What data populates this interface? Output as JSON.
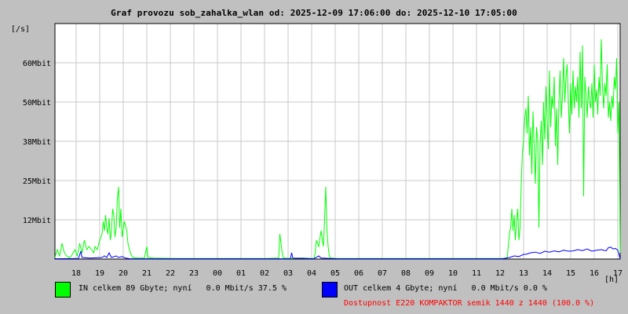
{
  "chart_data": {
    "type": "line",
    "title": "Graf provozu sob_zahalka_wlan od: 2025-12-09 17:06:00 do: 2025-12-10 17:05:00",
    "ylabel": "[/s]",
    "xlabel": "[h]",
    "x_ticks": [
      "18",
      "19",
      "20",
      "21",
      "22",
      "23",
      "00",
      "01",
      "02",
      "03",
      "04",
      "05",
      "06",
      "07",
      "08",
      "09",
      "10",
      "11",
      "12",
      "13",
      "14",
      "15",
      "16",
      "17"
    ],
    "y_ticks": [
      {
        "value": 12.5,
        "label": "12Mbit"
      },
      {
        "value": 25,
        "label": "25Mbit"
      },
      {
        "value": 37.5,
        "label": "38Mbit"
      },
      {
        "value": 50,
        "label": "50Mbit"
      },
      {
        "value": 62.5,
        "label": "60Mbit"
      }
    ],
    "x_range_hours": [
      0,
      24
    ],
    "ylim": [
      0,
      75
    ],
    "grid": true,
    "series": [
      {
        "name": "IN",
        "color": "#00ff00",
        "points": [
          [
            0.0,
            0.5
          ],
          [
            0.1,
            3
          ],
          [
            0.2,
            1
          ],
          [
            0.3,
            5
          ],
          [
            0.4,
            2
          ],
          [
            0.5,
            1
          ],
          [
            0.6,
            0.5
          ],
          [
            0.7,
            1
          ],
          [
            0.85,
            3
          ],
          [
            0.95,
            1
          ],
          [
            1.05,
            5
          ],
          [
            1.15,
            2
          ],
          [
            1.25,
            6
          ],
          [
            1.35,
            3
          ],
          [
            1.45,
            4
          ],
          [
            1.55,
            3
          ],
          [
            1.65,
            2
          ],
          [
            1.7,
            4
          ],
          [
            1.8,
            3
          ],
          [
            1.9,
            6
          ],
          [
            2.0,
            8
          ],
          [
            2.05,
            12
          ],
          [
            2.1,
            9
          ],
          [
            2.15,
            14
          ],
          [
            2.2,
            10
          ],
          [
            2.25,
            8
          ],
          [
            2.3,
            13
          ],
          [
            2.35,
            6
          ],
          [
            2.4,
            9
          ],
          [
            2.45,
            16
          ],
          [
            2.5,
            14
          ],
          [
            2.55,
            7
          ],
          [
            2.6,
            10
          ],
          [
            2.65,
            19
          ],
          [
            2.7,
            23
          ],
          [
            2.75,
            10
          ],
          [
            2.8,
            16
          ],
          [
            2.85,
            7
          ],
          [
            2.95,
            12
          ],
          [
            3.05,
            9
          ],
          [
            3.1,
            5
          ],
          [
            3.2,
            2
          ],
          [
            3.3,
            0.5
          ],
          [
            3.5,
            0.3
          ],
          [
            3.8,
            0.3
          ],
          [
            3.9,
            4
          ],
          [
            3.95,
            0.5
          ],
          [
            4.2,
            0.3
          ],
          [
            5.0,
            0.2
          ],
          [
            6.0,
            0.2
          ],
          [
            7.0,
            0.2
          ],
          [
            8.0,
            0.2
          ],
          [
            9.0,
            0.2
          ],
          [
            9.5,
            0.3
          ],
          [
            9.55,
            8
          ],
          [
            9.6,
            5
          ],
          [
            9.65,
            2
          ],
          [
            9.7,
            0.3
          ],
          [
            10.0,
            0.2
          ],
          [
            10.5,
            0.3
          ],
          [
            11.0,
            0.2
          ],
          [
            11.05,
            2
          ],
          [
            11.1,
            6
          ],
          [
            11.2,
            4
          ],
          [
            11.3,
            9
          ],
          [
            11.4,
            4
          ],
          [
            11.45,
            13
          ],
          [
            11.5,
            23
          ],
          [
            11.55,
            9
          ],
          [
            11.6,
            4
          ],
          [
            11.65,
            1
          ],
          [
            11.7,
            0.3
          ],
          [
            12.0,
            0.2
          ],
          [
            13.0,
            0.2
          ],
          [
            14.0,
            0.2
          ],
          [
            15.0,
            0.2
          ],
          [
            16.0,
            0.2
          ],
          [
            17.0,
            0.2
          ],
          [
            18.0,
            0.2
          ],
          [
            19.0,
            0.2
          ],
          [
            19.2,
            0.3
          ],
          [
            19.25,
            4
          ],
          [
            19.3,
            8
          ],
          [
            19.35,
            10
          ],
          [
            19.4,
            16
          ],
          [
            19.45,
            9
          ],
          [
            19.5,
            14
          ],
          [
            19.55,
            6
          ],
          [
            19.6,
            12
          ],
          [
            19.65,
            16
          ],
          [
            19.7,
            6
          ],
          [
            19.75,
            10
          ],
          [
            19.8,
            24
          ],
          [
            19.85,
            34
          ],
          [
            19.9,
            38
          ],
          [
            19.95,
            45
          ],
          [
            20.0,
            48
          ],
          [
            20.05,
            40
          ],
          [
            20.1,
            52
          ],
          [
            20.15,
            33
          ],
          [
            20.2,
            42
          ],
          [
            20.25,
            27
          ],
          [
            20.3,
            47
          ],
          [
            20.35,
            36
          ],
          [
            20.4,
            24
          ],
          [
            20.45,
            42
          ],
          [
            20.5,
            38
          ],
          [
            20.55,
            10
          ],
          [
            20.6,
            37
          ],
          [
            20.65,
            44
          ],
          [
            20.7,
            30
          ],
          [
            20.75,
            50
          ],
          [
            20.8,
            38
          ],
          [
            20.85,
            55
          ],
          [
            20.9,
            44
          ],
          [
            20.95,
            35
          ],
          [
            21.0,
            60
          ],
          [
            21.05,
            42
          ],
          [
            21.1,
            52
          ],
          [
            21.15,
            48
          ],
          [
            21.2,
            58
          ],
          [
            21.25,
            36
          ],
          [
            21.3,
            48
          ],
          [
            21.35,
            30
          ],
          [
            21.4,
            50
          ],
          [
            21.45,
            60
          ],
          [
            21.5,
            45
          ],
          [
            21.55,
            52
          ],
          [
            21.6,
            64
          ],
          [
            21.65,
            50
          ],
          [
            21.7,
            58
          ],
          [
            21.75,
            62
          ],
          [
            21.8,
            50
          ],
          [
            21.85,
            40
          ],
          [
            21.9,
            56
          ],
          [
            21.95,
            46
          ],
          [
            22.0,
            60
          ],
          [
            22.05,
            48
          ],
          [
            22.1,
            55
          ],
          [
            22.15,
            50
          ],
          [
            22.2,
            58
          ],
          [
            22.25,
            45
          ],
          [
            22.3,
            66
          ],
          [
            22.35,
            48
          ],
          [
            22.4,
            68
          ],
          [
            22.45,
            20
          ],
          [
            22.5,
            58
          ],
          [
            22.55,
            52
          ],
          [
            22.6,
            45
          ],
          [
            22.65,
            55
          ],
          [
            22.7,
            50
          ],
          [
            22.75,
            48
          ],
          [
            22.8,
            56
          ],
          [
            22.85,
            45
          ],
          [
            22.9,
            62
          ],
          [
            22.95,
            50
          ],
          [
            23.0,
            54
          ],
          [
            23.05,
            46
          ],
          [
            23.1,
            58
          ],
          [
            23.15,
            52
          ],
          [
            23.2,
            70
          ],
          [
            23.25,
            55
          ],
          [
            23.3,
            48
          ],
          [
            23.35,
            56
          ],
          [
            23.4,
            52
          ],
          [
            23.45,
            62
          ],
          [
            23.5,
            45
          ],
          [
            23.55,
            50
          ],
          [
            23.6,
            44
          ],
          [
            23.65,
            52
          ],
          [
            23.7,
            48
          ],
          [
            23.75,
            58
          ],
          [
            23.8,
            54
          ],
          [
            23.85,
            64
          ],
          [
            23.9,
            40
          ],
          [
            23.95,
            50
          ],
          [
            24.0,
            2
          ]
        ]
      },
      {
        "name": "OUT",
        "color": "#0000ff",
        "points": [
          [
            0.0,
            0.1
          ],
          [
            1.0,
            0.2
          ],
          [
            1.1,
            2.5
          ],
          [
            1.15,
            0.5
          ],
          [
            1.5,
            0.3
          ],
          [
            2.0,
            0.5
          ],
          [
            2.1,
            1
          ],
          [
            2.2,
            0.5
          ],
          [
            2.3,
            2
          ],
          [
            2.4,
            0.5
          ],
          [
            2.6,
            1
          ],
          [
            2.7,
            0.5
          ],
          [
            2.85,
            0.8
          ],
          [
            3.0,
            0.3
          ],
          [
            3.2,
            0.1
          ],
          [
            9.0,
            0.1
          ],
          [
            10.0,
            0.1
          ],
          [
            10.05,
            2
          ],
          [
            10.1,
            0.3
          ],
          [
            11.0,
            0.1
          ],
          [
            11.2,
            1
          ],
          [
            11.3,
            0.3
          ],
          [
            12.0,
            0.1
          ],
          [
            19.0,
            0.1
          ],
          [
            19.3,
            0.5
          ],
          [
            19.5,
            1
          ],
          [
            19.7,
            0.8
          ],
          [
            19.9,
            1.5
          ],
          [
            20.0,
            1.5
          ],
          [
            20.2,
            2
          ],
          [
            20.4,
            2.2
          ],
          [
            20.6,
            1.8
          ],
          [
            20.8,
            2.5
          ],
          [
            21.0,
            2.2
          ],
          [
            21.2,
            2.6
          ],
          [
            21.4,
            2.3
          ],
          [
            21.6,
            2.8
          ],
          [
            21.8,
            2.5
          ],
          [
            22.0,
            2.6
          ],
          [
            22.2,
            3.0
          ],
          [
            22.4,
            2.7
          ],
          [
            22.6,
            3.2
          ],
          [
            22.8,
            2.5
          ],
          [
            23.0,
            2.8
          ],
          [
            23.2,
            3.0
          ],
          [
            23.4,
            2.6
          ],
          [
            23.5,
            3.6
          ],
          [
            23.6,
            3.8
          ],
          [
            23.7,
            3.2
          ],
          [
            23.8,
            3.4
          ],
          [
            23.9,
            2.8
          ],
          [
            24.0,
            0.1
          ]
        ]
      }
    ]
  },
  "legend": {
    "in": {
      "color": "#00ff00",
      "text": "IN celkem 89 Gbyte; nyní   0.0 Mbit/s 37.5 %"
    },
    "out": {
      "color": "#0000ff",
      "text": "OUT celkem 4 Gbyte; nyní   0.0 Mbit/s 0.0 %"
    },
    "availability": "Dostupnost E220 KOMPAKTOR semik 1440 z 1440 (100.0 %)"
  }
}
